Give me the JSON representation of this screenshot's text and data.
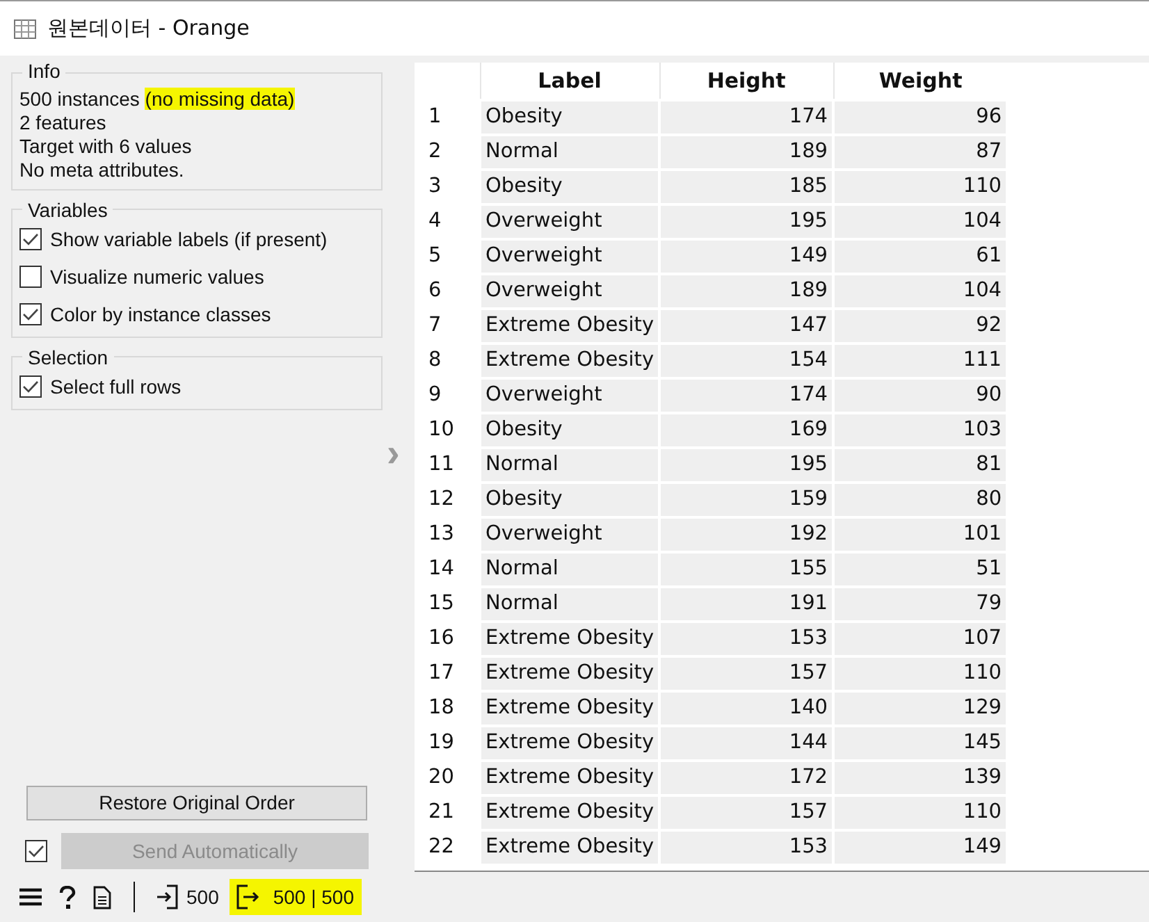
{
  "window": {
    "title": "원본데이터 - Orange"
  },
  "info": {
    "title": "Info",
    "lines": [
      [
        {
          "text": "500 instances ",
          "highlighted": false
        },
        {
          "text": "(no missing data)",
          "highlighted": true
        }
      ],
      [
        {
          "text": "2 features",
          "highlighted": false
        }
      ],
      [
        {
          "text": "Target with 6 values",
          "highlighted": false
        }
      ],
      [
        {
          "text": "No meta attributes.",
          "highlighted": false
        }
      ]
    ]
  },
  "variables": {
    "title": "Variables",
    "options": [
      {
        "label": "Show variable labels (if present)",
        "checked": true
      },
      {
        "label": "Visualize numeric values",
        "checked": false
      },
      {
        "label": "Color by instance classes",
        "checked": true
      }
    ]
  },
  "selection": {
    "title": "Selection",
    "options": [
      {
        "label": "Select full rows",
        "checked": true
      }
    ]
  },
  "restore_button": "Restore Original Order",
  "send_automatically": {
    "label": "Send Automatically",
    "checked": true,
    "disabled": true
  },
  "splitter": "›",
  "table": {
    "columns": [
      "",
      "Label",
      "Height",
      "Weight"
    ],
    "rows": [
      [
        "1",
        "Obesity",
        "174",
        "96"
      ],
      [
        "2",
        "Normal",
        "189",
        "87"
      ],
      [
        "3",
        "Obesity",
        "185",
        "110"
      ],
      [
        "4",
        "Overweight",
        "195",
        "104"
      ],
      [
        "5",
        "Overweight",
        "149",
        "61"
      ],
      [
        "6",
        "Overweight",
        "189",
        "104"
      ],
      [
        "7",
        "Extreme Obesity",
        "147",
        "92"
      ],
      [
        "8",
        "Extreme Obesity",
        "154",
        "111"
      ],
      [
        "9",
        "Overweight",
        "174",
        "90"
      ],
      [
        "10",
        "Obesity",
        "169",
        "103"
      ],
      [
        "11",
        "Normal",
        "195",
        "81"
      ],
      [
        "12",
        "Obesity",
        "159",
        "80"
      ],
      [
        "13",
        "Overweight",
        "192",
        "101"
      ],
      [
        "14",
        "Normal",
        "155",
        "51"
      ],
      [
        "15",
        "Normal",
        "191",
        "79"
      ],
      [
        "16",
        "Extreme Obesity",
        "153",
        "107"
      ],
      [
        "17",
        "Extreme Obesity",
        "157",
        "110"
      ],
      [
        "18",
        "Extreme Obesity",
        "140",
        "129"
      ],
      [
        "19",
        "Extreme Obesity",
        "144",
        "145"
      ],
      [
        "20",
        "Extreme Obesity",
        "172",
        "139"
      ],
      [
        "21",
        "Extreme Obesity",
        "157",
        "110"
      ],
      [
        "22",
        "Extreme Obesity",
        "153",
        "149"
      ]
    ]
  },
  "status_bar": {
    "input": {
      "text": "500",
      "highlighted": false
    },
    "output": {
      "text": "500 | 500",
      "highlighted": true
    }
  }
}
